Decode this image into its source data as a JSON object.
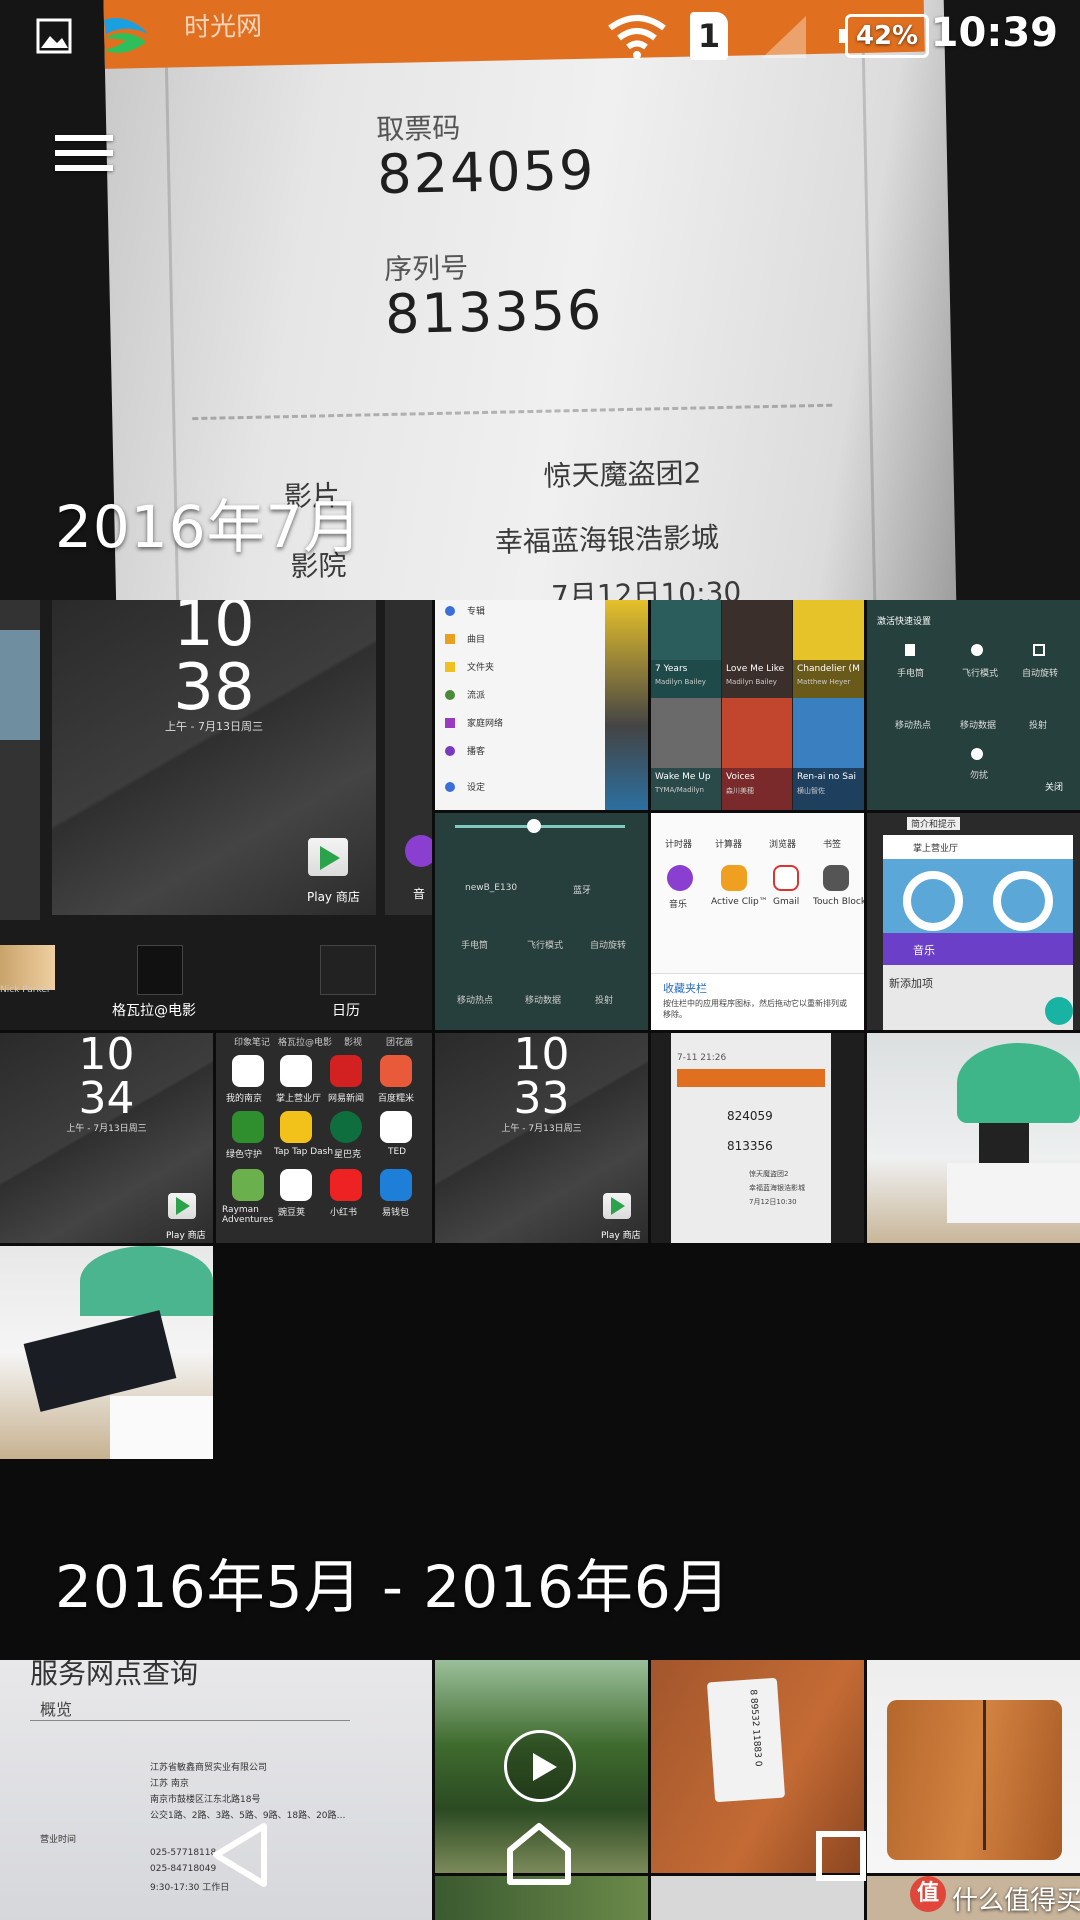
{
  "status_bar": {
    "time": "10:39",
    "battery": "42%",
    "sim": "1",
    "icons": [
      "image-icon",
      "china-mobile-logo-icon",
      "wifi-icon",
      "sim-1-icon",
      "cell-signal-icon",
      "battery-icon"
    ]
  },
  "toolbar": {
    "menu_icon": "hamburger-menu-icon"
  },
  "hero": {
    "brand": "时光网",
    "pickup_code_label": "取票码",
    "pickup_code": "824059",
    "serial_label": "序列号",
    "serial": "813356",
    "film_label": "影片",
    "film": "惊天魔盗团2",
    "cinema_label": "影院",
    "cinema": "幸福蓝海银浩影城",
    "time_partial": "7月12日10:30"
  },
  "sections": [
    {
      "title": "2016年7月"
    },
    {
      "title": "2016年5月 - 2016年6月"
    }
  ],
  "tiles": {
    "lock_main": {
      "hour": "10",
      "minute": "38",
      "date": "上午 - 7月13日周三",
      "app_label": "Play 商店",
      "music_label": "音"
    },
    "recents": {
      "app1": "格瓦拉@电影",
      "app2": "日历",
      "person1": "Nick Parker"
    },
    "drawer": {
      "items": [
        "专辑",
        "曲目",
        "文件夹",
        "流派",
        "家庭网络",
        "播客",
        "设定"
      ]
    },
    "music_grid": {
      "cells": [
        {
          "title": "7 Years",
          "artist": "Madilyn Bailey"
        },
        {
          "title": "Love Me Like",
          "artist": "Madilyn Bailey"
        },
        {
          "title": "Chandelier (M",
          "artist": "Matthew Heyer"
        },
        {
          "title": "Wake Me Up",
          "artist": "TYMA/Madilyn"
        },
        {
          "title": "Voices",
          "artist": "森川美穂"
        },
        {
          "title": "Ren-ai no Sai",
          "artist": "横山智佐"
        }
      ]
    },
    "quick_settings_a": {
      "header": "激活快速设置",
      "items": [
        "手电筒",
        "飞行模式",
        "自动旋转",
        "移动热点",
        "移动数据",
        "投射",
        "勿扰"
      ],
      "close": "关闭"
    },
    "quick_settings_b": {
      "wifi": "newB_E130",
      "bt": "蓝牙",
      "items": [
        "手电筒",
        "飞行模式",
        "自动旋转",
        "移动热点",
        "移动数据",
        "投射"
      ]
    },
    "apps_grid": {
      "apps": [
        "计时器",
        "计算器",
        "浏览器",
        "书签",
        "音乐",
        "Active Clip™",
        "Gmail",
        "Touch Block"
      ],
      "tray_title": "收藏夹栏",
      "tray_text": "按住栏中的应用程序图标，然后拖动它以重新排列或移除。"
    },
    "recents_b": {
      "card1": "掌上营业厅",
      "card2": "音乐",
      "add": "新添加项",
      "top": "简介和提示"
    },
    "lock_2": {
      "hour": "10",
      "minute": "34",
      "date": "上午 - 7月13日周三",
      "app_label": "Play 商店"
    },
    "home_apps": {
      "top": [
        "印象笔记",
        "格瓦拉@电影",
        "影视",
        "团花画"
      ],
      "apps": [
        "我的南京",
        "掌上营业厅",
        "网易新闻",
        "百度糯米",
        "绿色守护",
        "Tap Tap Dash",
        "星巴克",
        "TED",
        "Rayman Adventures",
        "豌豆荚",
        "小红书",
        "易钱包"
      ]
    },
    "lock_3": {
      "hour": "10",
      "minute": "33",
      "date": "上午 - 7月13日周三",
      "app_label": "Play 商店"
    },
    "ticket_thumb": {
      "time": "7-11 21:26",
      "code": "824059",
      "serial": "813356",
      "film": "惊天魔盗团2",
      "cinema": "幸福蓝海银浩影城",
      "show": "7月12日10:30"
    }
  },
  "bottom_tiles": {
    "doc": {
      "title": "服务网点查询",
      "subtitle": "概览",
      "rows": [
        "江苏省敏鑫商贸实业有限公司",
        "江苏 南京",
        "南京市鼓楼区江东北路18号",
        "公交1路、2路、3路、5路、9路、18路、20路…",
        "营业时间",
        "025-57718118",
        "025-84718049",
        "9:30-17:30 工作日"
      ]
    },
    "tag": {
      "code": "8 89532 11883 0"
    }
  },
  "nav": {
    "back_icon": "back-triangle-icon",
    "home_icon": "home-icon",
    "recents_icon": "recents-square-icon",
    "play_icon": "video-play-icon"
  },
  "watermark": {
    "logo": "值",
    "text": "什么值得买"
  }
}
